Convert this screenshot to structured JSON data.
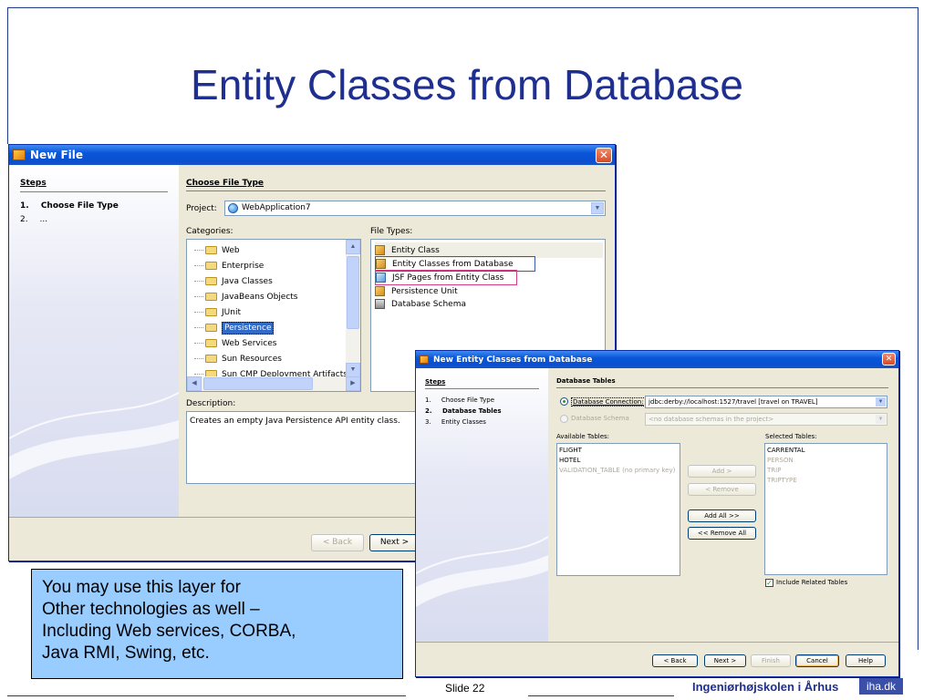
{
  "slide": {
    "title": "Entity Classes from Database",
    "slide_number": "Slide 22",
    "school": "Ingeniørhøjskolen i Århus",
    "logo_text": "iha.dk"
  },
  "note_box": {
    "lines": [
      "You may use this layer for",
      "Other technologies as well –",
      "Including Web services, CORBA,",
      "Java RMI, Swing, etc."
    ]
  },
  "new_file": {
    "title": "New File",
    "steps_header": "Steps",
    "steps": [
      {
        "num": "1.",
        "label": "Choose File Type"
      },
      {
        "num": "2.",
        "label": "..."
      }
    ],
    "section_title": "Choose File Type",
    "project_label": "Project:",
    "project_value": "WebApplication7",
    "categories_label": "Categories:",
    "categories": [
      "Web",
      "Enterprise",
      "Java Classes",
      "JavaBeans Objects",
      "JUnit",
      "Persistence",
      "Web Services",
      "Sun Resources",
      "Sun CMP Deployment Artifacts"
    ],
    "selected_category": "Persistence",
    "file_types_label": "File Types:",
    "file_types": [
      "Entity Class",
      "Entity Classes from Database",
      "JSF Pages from Entity Class",
      "Persistence Unit",
      "Database Schema"
    ],
    "description_label": "Description:",
    "description": "Creates an empty Java Persistence API entity class.",
    "back_button": "< Back",
    "next_button": "Next >"
  },
  "entity_dialog": {
    "title": "New Entity Classes from Database",
    "steps_header": "Steps",
    "steps": [
      {
        "num": "1.",
        "label": "Choose File Type"
      },
      {
        "num": "2.",
        "label": "Database Tables"
      },
      {
        "num": "3.",
        "label": "Entity Classes"
      }
    ],
    "section_title": "Database Tables",
    "db_connection_label": "Database Connection:",
    "db_connection_value": "jdbc:derby://localhost:1527/travel [travel on TRAVEL]",
    "db_schema_label": "Database Schema",
    "db_schema_placeholder": "<no database schemas in the project>",
    "available_label": "Available Tables:",
    "available_tables": [
      "FLIGHT",
      "HOTEL",
      "VALIDATION_TABLE (no primary key)"
    ],
    "selected_label": "Selected Tables:",
    "selected_tables": [
      "CARRENTAL",
      "PERSON",
      "TRIP",
      "TRIPTYPE"
    ],
    "add_button": "Add >",
    "remove_button": "< Remove",
    "add_all_button": "Add All >>",
    "remove_all_button": "<< Remove All",
    "include_related": "Include Related Tables",
    "back_button": "< Back",
    "next_button": "Next >",
    "finish_button": "Finish",
    "cancel_button": "Cancel",
    "help_button": "Help"
  },
  "colors": {
    "title_blue": "#1f2f8f",
    "note_bg": "#99ccff",
    "xp_title": "#0a56d8"
  }
}
